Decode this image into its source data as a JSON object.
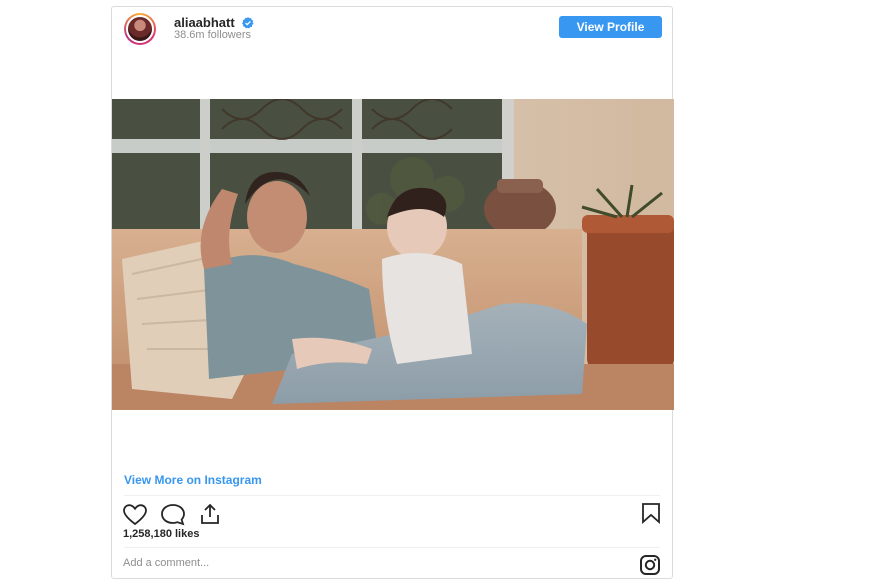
{
  "post": {
    "username": "aliaabhatt",
    "followers": "38.6m followers",
    "view_profile_label": "View Profile",
    "view_more_label": "View More on Instagram",
    "likes": "1,258,180 likes",
    "comment_placeholder": "Add a comment...",
    "photo_alt": "Photo posted by aliaabhatt"
  },
  "icons": {
    "verified": "verified-badge-icon",
    "like": "heart-icon",
    "comment": "comment-bubble-icon",
    "share": "share-icon",
    "save": "bookmark-icon",
    "brand": "instagram-logo-icon"
  },
  "colors": {
    "accent": "#3897f0",
    "border": "#dbdbdb",
    "muted": "#8e8e8e"
  }
}
